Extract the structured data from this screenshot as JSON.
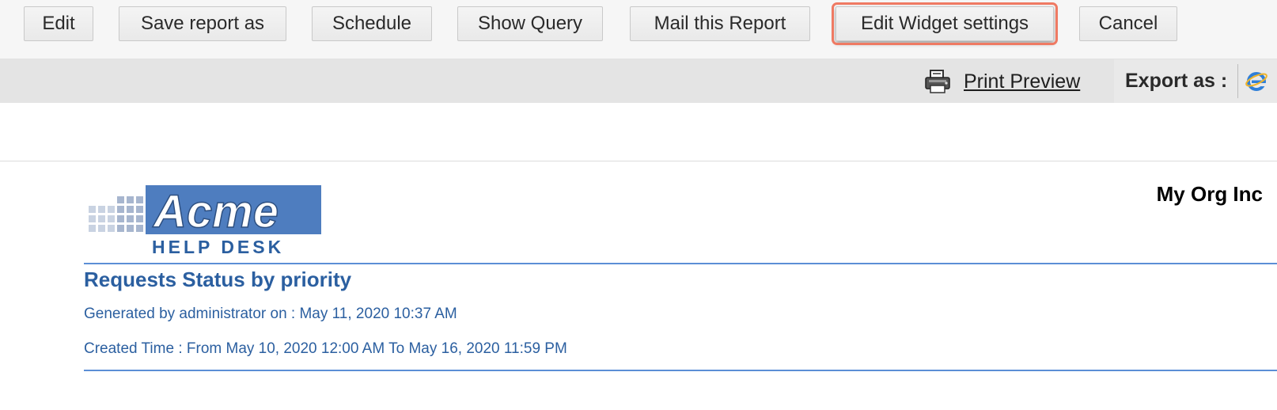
{
  "toolbar": {
    "buttons": [
      {
        "label": "Edit"
      },
      {
        "label": "Save report as"
      },
      {
        "label": "Schedule"
      },
      {
        "label": "Show Query"
      },
      {
        "label": "Mail this Report"
      },
      {
        "label": "Edit Widget settings",
        "highlighted": true
      },
      {
        "label": "Cancel"
      }
    ]
  },
  "subbar": {
    "print_preview": "Print Preview",
    "export_label": "Export as :",
    "icons": [
      "printer-icon",
      "internet-explorer-icon"
    ]
  },
  "report": {
    "logo": {
      "brand": "Acme",
      "tagline": "HELP DESK"
    },
    "org_name": "My Org Inc",
    "title": "Requests Status by priority",
    "generated": "Generated by administrator on : May 11, 2020 10:37 AM",
    "created_time": "Created Time : From May 10, 2020 12:00 AM To May 16, 2020 11:59 PM"
  },
  "colors": {
    "accent_blue": "#2b5fa0",
    "rule_blue": "#5b8fd6",
    "highlight": "#ef7a63"
  }
}
